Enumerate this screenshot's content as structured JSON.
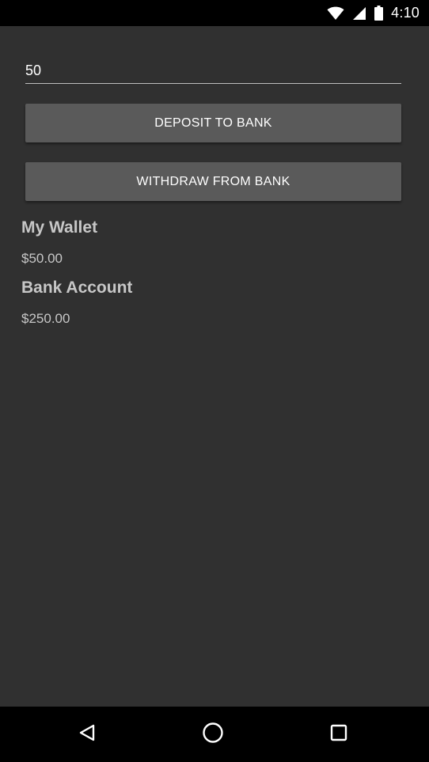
{
  "status_bar": {
    "time": "4:10",
    "icons": [
      "wifi-icon",
      "signal-icon",
      "battery-icon"
    ]
  },
  "amount_input": {
    "value": "50",
    "placeholder": ""
  },
  "buttons": {
    "deposit_label": "DEPOSIT TO BANK",
    "withdraw_label": "WITHDRAW FROM BANK"
  },
  "wallet": {
    "title": "My Wallet",
    "amount": "$50.00"
  },
  "bank_account": {
    "title": "Bank Account",
    "amount": "$250.00"
  },
  "nav_bar": {
    "icons": [
      "back-icon",
      "home-icon",
      "recents-icon"
    ]
  },
  "colors": {
    "background": "#303030",
    "button": "#5a5a5a",
    "text": "#c7c7c7",
    "bars": "#000000"
  }
}
